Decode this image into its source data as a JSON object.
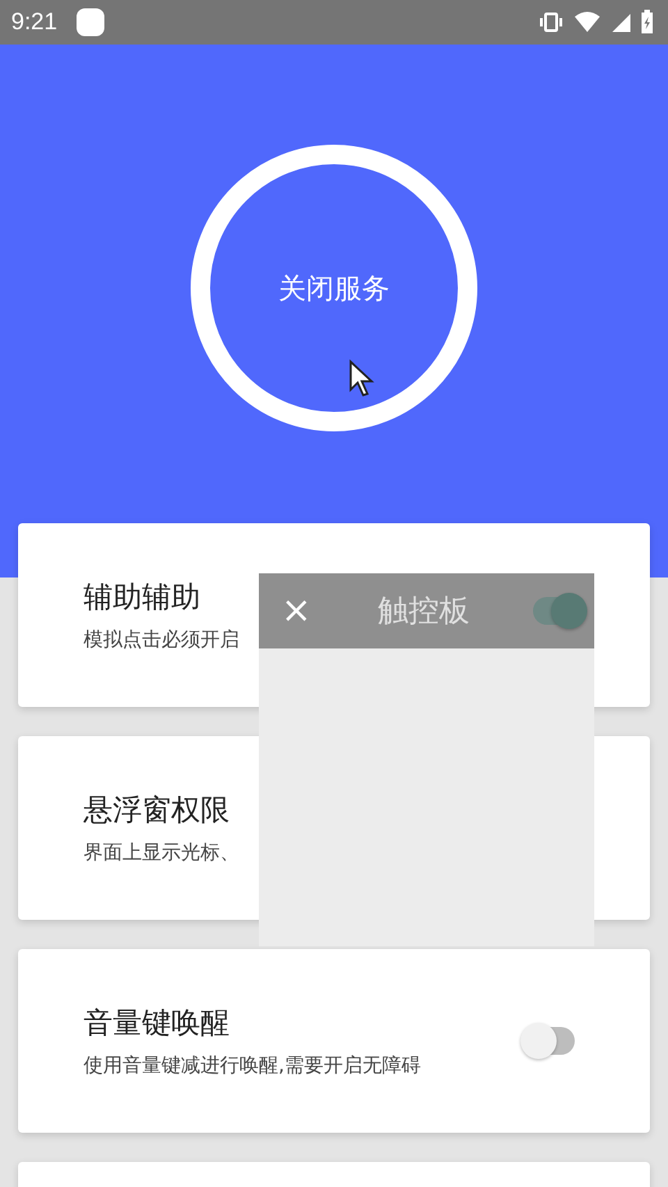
{
  "status_bar": {
    "time": "9:21"
  },
  "hero": {
    "button_label": "关闭服务"
  },
  "settings": [
    {
      "title": "辅助辅助",
      "subtitle": "模拟点击必须开启"
    },
    {
      "title": "悬浮窗权限",
      "subtitle": "界面上显示光标、"
    },
    {
      "title": "音量键唤醒",
      "subtitle": "使用音量键减进行唤醒,需要开启无障碍",
      "on": false
    }
  ],
  "touchpad": {
    "close": "×",
    "title": "触控板",
    "on": true
  }
}
